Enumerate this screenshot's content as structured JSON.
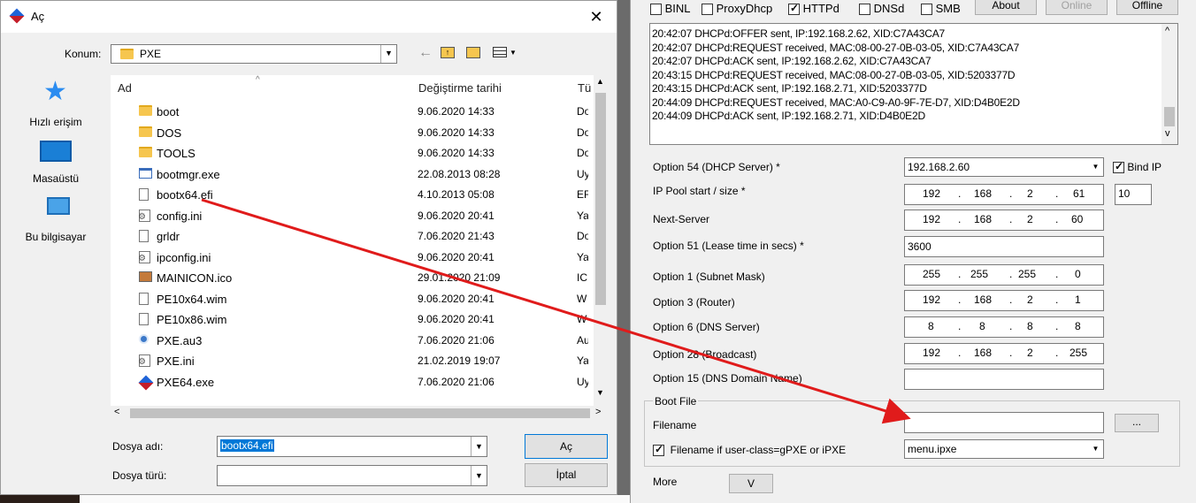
{
  "dialog": {
    "title": "Aç",
    "location_label": "Konum:",
    "location_value": "PXE",
    "places": [
      {
        "label": "Hızlı erişim",
        "icon": "quick-access-star-icon"
      },
      {
        "label": "Masaüstü",
        "icon": "desktop-icon"
      },
      {
        "label": "Bu bilgisayar",
        "icon": "computer-icon"
      }
    ],
    "columns": {
      "name": "Ad",
      "date": "Değiştirme tarihi",
      "type": "Tü"
    },
    "files": [
      {
        "name": "boot",
        "date": "9.06.2020 14:33",
        "type": "Do",
        "icon": "folder-icon"
      },
      {
        "name": "DOS",
        "date": "9.06.2020 14:33",
        "type": "Do",
        "icon": "folder-icon"
      },
      {
        "name": "TOOLS",
        "date": "9.06.2020 14:33",
        "type": "Do",
        "icon": "folder-icon"
      },
      {
        "name": "bootmgr.exe",
        "date": "22.08.2013 08:28",
        "type": "Uy",
        "icon": "exe-file-icon"
      },
      {
        "name": "bootx64.efi",
        "date": "4.10.2013 05:08",
        "type": "EF",
        "icon": "file-icon"
      },
      {
        "name": "config.ini",
        "date": "9.06.2020 20:41",
        "type": "Ya",
        "icon": "settings-file-icon"
      },
      {
        "name": "grldr",
        "date": "7.06.2020 21:43",
        "type": "Do",
        "icon": "file-icon"
      },
      {
        "name": "ipconfig.ini",
        "date": "9.06.2020 20:41",
        "type": "Ya",
        "icon": "settings-file-icon"
      },
      {
        "name": "MAINICON.ico",
        "date": "29.01.2020 21:09",
        "type": "IC",
        "icon": "image-file-icon"
      },
      {
        "name": "PE10x64.wim",
        "date": "9.06.2020 20:41",
        "type": "W",
        "icon": "file-icon"
      },
      {
        "name": "PE10x86.wim",
        "date": "9.06.2020 20:41",
        "type": "W",
        "icon": "file-icon"
      },
      {
        "name": "PXE.au3",
        "date": "7.06.2020 21:06",
        "type": "Au",
        "icon": "autoit-file-icon"
      },
      {
        "name": "PXE.ini",
        "date": "21.02.2019 19:07",
        "type": "Ya",
        "icon": "settings-file-icon"
      },
      {
        "name": "PXE64.exe",
        "date": "7.06.2020 21:06",
        "type": "Uy",
        "icon": "app-cube-icon"
      }
    ],
    "filename_label": "Dosya adı:",
    "filename_value": "bootx64.efi",
    "filetype_label": "Dosya türü:",
    "filetype_value": "",
    "open_button": "Aç",
    "cancel_button": "İptal"
  },
  "app": {
    "services": [
      {
        "label": "BINL",
        "checked": false
      },
      {
        "label": "ProxyDhcp",
        "checked": false
      },
      {
        "label": "HTTPd",
        "checked": true
      },
      {
        "label": "DNSd",
        "checked": false
      },
      {
        "label": "SMB",
        "checked": false
      }
    ],
    "buttons": {
      "about": "About",
      "online": "Online",
      "offline": "Offline",
      "browse": "...",
      "more": "V"
    },
    "log": [
      "20:42:07 DHCPd:OFFER sent, IP:192.168.2.62, XID:C7A43CA7",
      "20:42:07 DHCPd:REQUEST received, MAC:08-00-27-0B-03-05, XID:C7A43CA7",
      "20:42:07 DHCPd:ACK sent, IP:192.168.2.62, XID:C7A43CA7",
      "20:43:15 DHCPd:REQUEST received, MAC:08-00-27-0B-03-05, XID:5203377D",
      "20:43:15 DHCPd:ACK sent, IP:192.168.2.71, XID:5203377D",
      "20:44:09 DHCPd:REQUEST received, MAC:A0-C9-A0-9F-7E-D7, XID:D4B0E2D",
      "20:44:09 DHCPd:ACK sent, IP:192.168.2.71, XID:D4B0E2D"
    ],
    "options": {
      "opt54_label": "Option 54 (DHCP Server) *",
      "opt54_value": "192.168.2.60",
      "bind_ip_label": "Bind IP",
      "pool_label": "IP Pool start / size *",
      "pool_ip": [
        "192",
        "168",
        "2",
        "61"
      ],
      "pool_size": "10",
      "next_server_label": "Next-Server",
      "next_server_ip": [
        "192",
        "168",
        "2",
        "60"
      ],
      "opt51_label": "Option 51 (Lease time in secs) *",
      "opt51_value": "3600",
      "opt1_label": "Option 1  (Subnet Mask)",
      "opt1_ip": [
        "255",
        "255",
        "255",
        "0"
      ],
      "opt3_label": "Option 3  (Router)",
      "opt3_ip": [
        "192",
        "168",
        "2",
        "1"
      ],
      "opt6_label": "Option 6  (DNS Server)",
      "opt6_ip": [
        "8",
        "8",
        "8",
        "8"
      ],
      "opt28_label": "Option 28 (Broadcast)",
      "opt28_ip": [
        "192",
        "168",
        "2",
        "255"
      ],
      "opt15_label": "Option 15 (DNS Domain Name)",
      "opt15_value": ""
    },
    "boot": {
      "group_label": "Boot File",
      "filename_label": "Filename",
      "filename_value": "",
      "ipxe_label": "Filename if user-class=gPXE or iPXE",
      "ipxe_value": "menu.ipxe",
      "more_label": "More"
    }
  },
  "annotation_arrow_color": "#e01b1b"
}
